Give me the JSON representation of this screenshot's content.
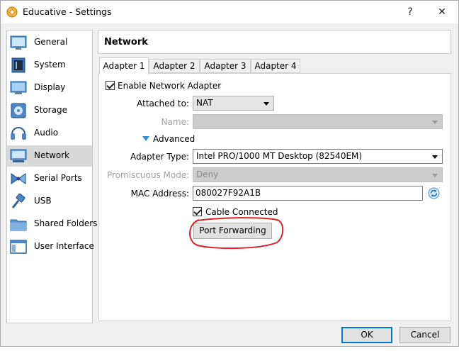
{
  "window": {
    "title": "Educative - Settings",
    "help_label": "?",
    "close_label": "✕"
  },
  "sidebar": {
    "items": [
      {
        "label": "General",
        "icon": "general-icon"
      },
      {
        "label": "System",
        "icon": "system-icon"
      },
      {
        "label": "Display",
        "icon": "display-icon"
      },
      {
        "label": "Storage",
        "icon": "storage-icon"
      },
      {
        "label": "Audio",
        "icon": "audio-icon"
      },
      {
        "label": "Network",
        "icon": "network-icon",
        "selected": true
      },
      {
        "label": "Serial Ports",
        "icon": "serial-ports-icon"
      },
      {
        "label": "USB",
        "icon": "usb-icon"
      },
      {
        "label": "Shared Folders",
        "icon": "shared-folders-icon"
      },
      {
        "label": "User Interface",
        "icon": "user-interface-icon"
      }
    ]
  },
  "section": {
    "title": "Network"
  },
  "tabs": [
    {
      "label": "Adapter 1",
      "active": true
    },
    {
      "label": "Adapter 2"
    },
    {
      "label": "Adapter 3"
    },
    {
      "label": "Adapter 4"
    }
  ],
  "form": {
    "enable_label": "Enable Network Adapter",
    "enable_checked": true,
    "attached_label": "Attached to:",
    "attached_value": "NAT",
    "name_label": "Name:",
    "name_value": "",
    "advanced_label": "Advanced",
    "adapter_type_label": "Adapter Type:",
    "adapter_type_value": "Intel PRO/1000 MT Desktop (82540EM)",
    "promiscuous_label": "Promiscuous Mode:",
    "promiscuous_value": "Deny",
    "mac_label": "MAC Address:",
    "mac_value": "080027F92A1B",
    "cable_label": "Cable Connected",
    "cable_checked": true,
    "port_forwarding_label": "Port Forwarding"
  },
  "footer": {
    "ok_label": "OK",
    "cancel_label": "Cancel"
  },
  "colors": {
    "accent": "#0078d7",
    "annotation": "#e0202a",
    "selected_item": "#d9d9d9"
  }
}
